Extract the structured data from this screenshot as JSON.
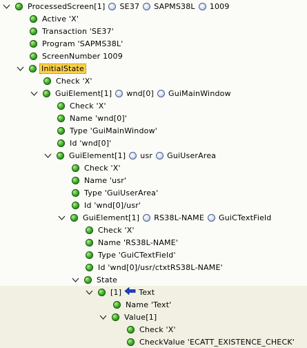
{
  "tree": {
    "root_label": "ProcessedScreen[1]",
    "root_parts": [
      "SE37",
      "SAPMS38L",
      "1009"
    ],
    "active": "Active 'X'",
    "transaction": "Transaction 'SE37'",
    "program": "Program 'SAPMS38L'",
    "screen_number": "ScreenNumber 1009",
    "initial_state": "InitialState",
    "check_1": "Check 'X'",
    "gui_el_1_label": "GuiElement[1]",
    "gui_el_1_parts": [
      "wnd[0]",
      "GuiMainWindow"
    ],
    "check_2": "Check 'X'",
    "name_wnd": "Name 'wnd[0]'",
    "type_mainwin": "Type 'GuiMainWindow'",
    "id_wnd": "Id 'wnd[0]'",
    "gui_el_2_label": "GuiElement[1]",
    "gui_el_2_parts": [
      "usr",
      "GuiUserArea"
    ],
    "check_3": "Check 'X'",
    "name_usr": "Name 'usr'",
    "type_userarea": "Type 'GuiUserArea'",
    "id_usr": "Id 'wnd[0]/usr'",
    "gui_el_3_label": "GuiElement[1]",
    "gui_el_3_parts": [
      "RS38L-NAME",
      "GuiCTextField"
    ],
    "check_4": "Check 'X'",
    "name_rs38l": "Name 'RS38L-NAME'",
    "type_ctext": "Type 'GuiCTextField'",
    "id_ctxt": "Id 'wnd[0]/usr/ctxtRS38L-NAME'",
    "state": "State",
    "state_item_index": "[1]",
    "state_item_text": "Text",
    "name_text": "Name 'Text'",
    "value": "Value[1]",
    "check_5": "Check 'X'",
    "check_value": "CheckValue 'ECATT_EXISTENCE_CHECK'"
  }
}
